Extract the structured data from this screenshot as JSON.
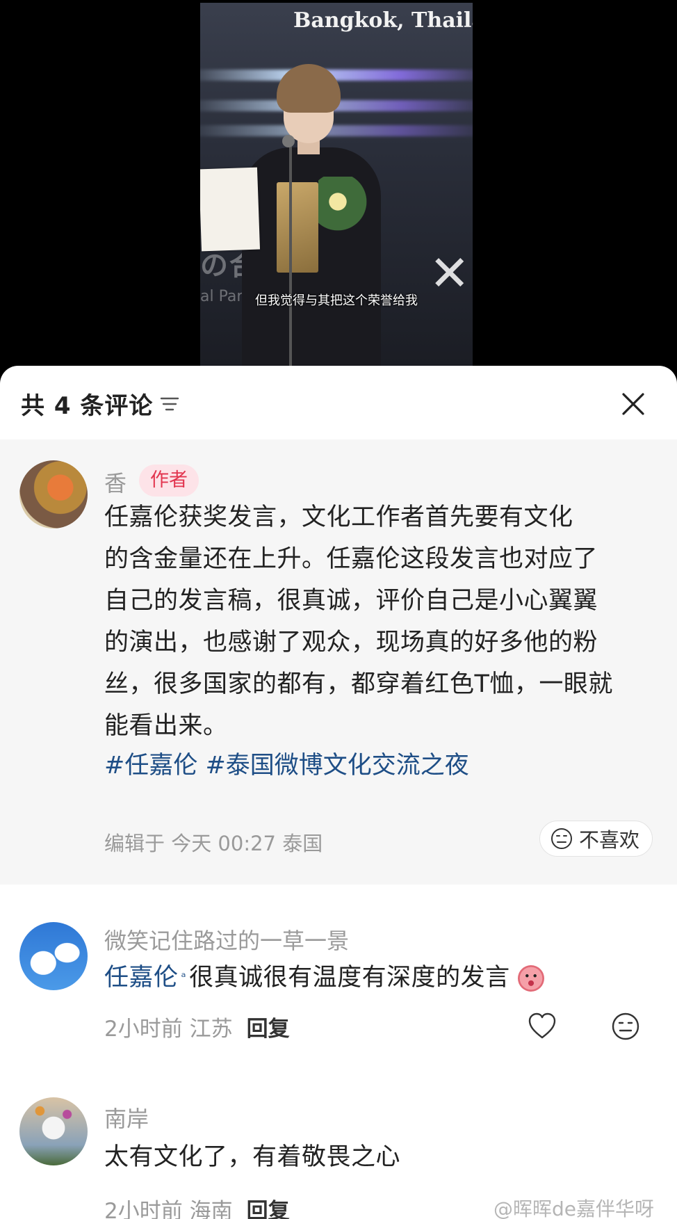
{
  "video": {
    "location_text": "Bangkok, Thailan",
    "backdrop_text": "の合作",
    "backdrop_text2": "al Part",
    "subtitle": "但我觉得与其把这个荣誉给我"
  },
  "sheet": {
    "comment_count": "共 4 条评论"
  },
  "author_comment": {
    "username": "香",
    "badge": "作者",
    "text_lines": [
      "任嘉伦获奖发言，文化工作者首先要有文化",
      "的含金量还在上升。任嘉伦这段发言也对应了",
      "自己的发言稿，很真诚，评价自己是小心翼翼",
      "的演出，也感谢了观众，现场真的好多他的粉",
      "丝，很多国家的都有，都穿着红色T恤，一眼就",
      "能看出来。"
    ],
    "tags": [
      "#任嘉伦",
      "#泰国微博文化交流之夜"
    ],
    "meta": "编辑于 今天 00:27 泰国",
    "dislike_label": "不喜欢"
  },
  "comments": [
    {
      "username": "微笑记住路过的一草一景",
      "mention": "任嘉伦",
      "text": "很真诚很有温度有深度的发言",
      "time": "2小时前 江苏",
      "reply_label": "回复"
    },
    {
      "username": "南岸",
      "text": "太有文化了，有着敬畏之心",
      "time": "2小时前 海南",
      "reply_label": "回复"
    }
  ],
  "watermark": "@晖晖de嘉伴华呀",
  "colors": {
    "author_badge_bg": "#fde3e8",
    "author_badge_text": "#e2354f",
    "tag_blue": "#1e4e86",
    "meta_gray": "#9a9a9a"
  }
}
